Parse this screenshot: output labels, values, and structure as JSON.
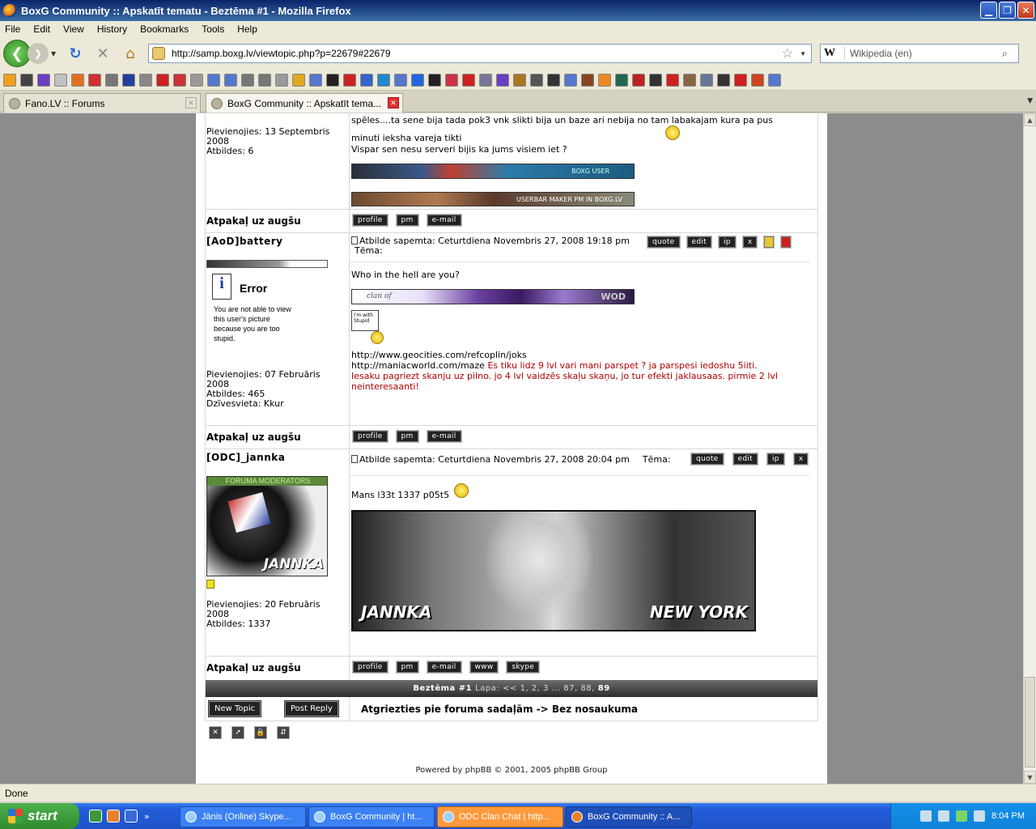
{
  "window": {
    "title": "BoxG Community :: Apskatīt tematu - Beztēma #1 - Mozilla Firefox",
    "minimize": "▁",
    "maximize": "❐",
    "close": "✕"
  },
  "menu": [
    "File",
    "Edit",
    "View",
    "History",
    "Bookmarks",
    "Tools",
    "Help"
  ],
  "nav": {
    "back": "❮",
    "forward": "❯",
    "reload": "↻",
    "stop": "✕",
    "home": "⌂",
    "url": "http://samp.boxg.lv/viewtopic.php?p=22679#22679",
    "search_engine": "W",
    "search_placeholder": "Wikipedia (en)"
  },
  "bookmark_icons": [
    "#f0a020",
    "#444",
    "#6a3fc0",
    "#c0c0c0",
    "#e07020",
    "#d03030",
    "#777",
    "#2040a0",
    "#888",
    "#cc2222",
    "#cc3333",
    "#999",
    "#5577cc",
    "#5577cc",
    "#777",
    "#777",
    "#999",
    "#ddaa22",
    "#5577cc",
    "#222",
    "#cc2222",
    "#3366cc",
    "#2288cc",
    "#5577cc",
    "#2266dd",
    "#222",
    "#cc3344",
    "#cc2222",
    "#777799",
    "#6a3fc0",
    "#aa7722",
    "#555",
    "#333",
    "#5577cc",
    "#884422",
    "#ee8822",
    "#226655",
    "#bb2222",
    "#333",
    "#cc2222",
    "#886644",
    "#667799",
    "#333",
    "#cc2222",
    "#cc4422",
    "#5577cc"
  ],
  "tabs": [
    {
      "label": "Fano.LV :: Forums"
    },
    {
      "label": "BoxG Community :: Apskatīt tema..."
    }
  ],
  "post0": {
    "joined": "Pievienojies: 13 Septembris 2008",
    "replies": "Atbildes: 6",
    "line1": "spēles....ta sene bija tada pok3 vnk slikti bija un baze ari nebija no tam labakajam kura pa pus",
    "line2": "minuti ieksha vareja tikti",
    "line3": "Vispar sen nesu serveri bijis ka jums visiem iet ?",
    "banner1": "BOXG USER",
    "banner2": "USERBAR MAKER PM IN BOXG.LV"
  },
  "back_to_top": "Atpakaļ uz augšu",
  "buttons": {
    "profile": "profile",
    "pm": "pm",
    "email": "e-mail",
    "www": "www",
    "skype": "skype",
    "quote": "quote",
    "edit": "edit",
    "ip": "ip",
    "delete": "x"
  },
  "post1": {
    "username": "[AoD]battery",
    "info": "Atbilde sapemta: Ceturtdiena Novembris 27, 2008 19:18 pm",
    "topic_label": "Tēma:",
    "error_title": "Error",
    "error_text": "You are not able to view this user's picture because you are too stupid.",
    "joined": "Pievienojies: 07 Februāris 2008",
    "replies": "Atbildes: 465",
    "location": "Dzīvesvieta: Kkur",
    "text": "Who in the hell are you?",
    "banner": "clan of",
    "banner_logo": "WOD",
    "sign_text": "I'm with Stupid",
    "link1": "http://www.geocities.com/refcoplin/joks",
    "link2": "http://maniacworld.com/maze",
    "red1": "Es tiku lidz 9 lvl vari mani parspet ? ja parspesi iedoshu 5iiti.",
    "red2": "Iesaku pagriezt skanju uz pilno. jo 4 lvl vaidzēs skaļu skaņu, jo tur efekti jaklausaas. pirmie 2 lvl neinteresaanti!"
  },
  "post2": {
    "username": "[ODC]_jannka",
    "info": "Atbilde sapemta: Ceturtdiena Novembris 27, 2008 20:04 pm",
    "topic_label": "Tēma:",
    "rank": "FORUMA MODERATORS",
    "avatar_name": "JANNKA",
    "joined": "Pievienojies: 20 Februāris 2008",
    "replies": "Atbildes: 1337",
    "text": "Mans l33t 1337 p05t5",
    "sig_left": "JANNKA",
    "sig_right": "NEW YORK"
  },
  "pagination": {
    "topic": "Beztēma #1",
    "label": "Lapa:",
    "pages": "<< 1, 2, 3 ... 87, 88,",
    "current": "89"
  },
  "actions": {
    "new_topic": "New Topic",
    "post_reply": "Post Reply",
    "return": "Atgriezties pie foruma sadaļām -> Bez nosaukuma"
  },
  "mod_icons": [
    "✕",
    "➚",
    "🔒",
    "⇵"
  ],
  "footer": "Powered by phpBB © 2001, 2005 phpBB Group",
  "status": "Done",
  "taskbar": {
    "start": "start",
    "tasks": [
      {
        "label": "Jānis (Online) Skype..."
      },
      {
        "label": "BoxG Community | ht..."
      },
      {
        "label": "ODC Clan Chat | http..."
      },
      {
        "label": "BoxG Community :: A..."
      }
    ],
    "clock": "8:04 PM"
  }
}
